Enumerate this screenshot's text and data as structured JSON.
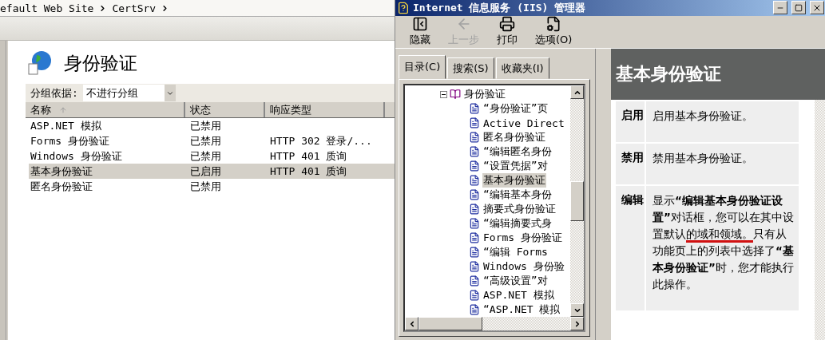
{
  "breadcrumb": [
    "efault Web Site",
    "CertSrv"
  ],
  "feature": {
    "title": "身份验证"
  },
  "group_by": {
    "label": "分组依据:",
    "value": "不进行分组"
  },
  "table": {
    "columns": [
      "名称",
      "状态",
      "响应类型"
    ],
    "rows": [
      {
        "name": "ASP.NET 模拟",
        "status": "已禁用",
        "response": "",
        "selected": false
      },
      {
        "name": "Forms 身份验证",
        "status": "已禁用",
        "response": "HTTP 302 登录/...",
        "selected": false
      },
      {
        "name": "Windows 身份验证",
        "status": "已禁用",
        "response": "HTTP 401 质询",
        "selected": false
      },
      {
        "name": "基本身份验证",
        "status": "已启用",
        "response": "HTTP 401 质询",
        "selected": true
      },
      {
        "name": "匿名身份验证",
        "status": "已禁用",
        "response": "",
        "selected": false
      }
    ]
  },
  "help_window": {
    "title": "Internet 信息服务 (IIS) 管理器",
    "toolbar": [
      {
        "kind": "hide",
        "label": "隐藏",
        "disabled": false
      },
      {
        "kind": "back",
        "label": "上一步",
        "disabled": true
      },
      {
        "kind": "print",
        "label": "打印",
        "disabled": false
      },
      {
        "kind": "options",
        "label": "选项(O)",
        "disabled": false
      }
    ],
    "tabs": [
      {
        "label": "目录(C)",
        "selected": true
      },
      {
        "label": "搜索(S)",
        "selected": false
      },
      {
        "label": "收藏夹(I)",
        "selected": false
      }
    ],
    "tree": [
      {
        "label": "身份验证",
        "expanded": true,
        "selected": false,
        "children": [
          {
            "label": "“身份验证”页",
            "selected": false
          },
          {
            "label": "Active Direct",
            "selected": false
          },
          {
            "label": "匿名身份验证",
            "selected": false
          },
          {
            "label": "“编辑匿名身份",
            "selected": false
          },
          {
            "label": "“设置凭据”对",
            "selected": false
          },
          {
            "label": "基本身份验证",
            "selected": true
          },
          {
            "label": "“编辑基本身份",
            "selected": false
          },
          {
            "label": "摘要式身份验证",
            "selected": false
          },
          {
            "label": "“编辑摘要式身",
            "selected": false
          },
          {
            "label": "Forms 身份验证",
            "selected": false
          },
          {
            "label": "“编辑 Forms",
            "selected": false
          },
          {
            "label": "Windows 身份验",
            "selected": false
          },
          {
            "label": "“高级设置”对",
            "selected": false
          },
          {
            "label": "ASP.NET 模拟",
            "selected": false
          },
          {
            "label": "“ASP.NET 模拟",
            "selected": false
          }
        ]
      }
    ],
    "topic": {
      "title": "基本身份验证",
      "rows": [
        {
          "term": "启用",
          "description": [
            {
              "kind": "plain",
              "text": "启用基本身份验证。"
            }
          ]
        },
        {
          "term": "禁用",
          "description": [
            {
              "kind": "plain",
              "text": "禁用基本身份验证。"
            }
          ]
        },
        {
          "term": "编辑",
          "description": [
            {
              "kind": "plain",
              "text": "显示"
            },
            {
              "kind": "bold",
              "text": "“编辑基本身份验证设置”"
            },
            {
              "kind": "plain",
              "text": "对话框，您可以在其中设置默认"
            },
            {
              "kind": "marked",
              "text": "的域和领域。"
            },
            {
              "kind": "plain",
              "text": "只有从功能页上的列表中选择了"
            },
            {
              "kind": "bold",
              "text": "“基本身份验证”"
            },
            {
              "kind": "plain",
              "text": "时，您才能执行此操作。"
            }
          ]
        }
      ]
    }
  }
}
